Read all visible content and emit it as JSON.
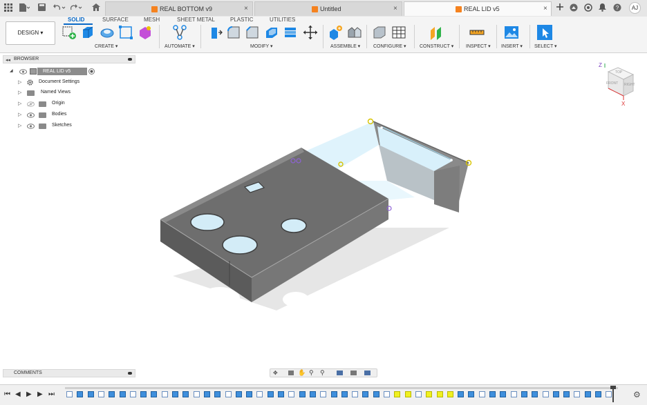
{
  "tabs": [
    {
      "label": "REAL BOTTOM v9",
      "close": "×"
    },
    {
      "label": "Untitled",
      "close": "×"
    },
    {
      "label": "REAL LID v5",
      "close": "×"
    }
  ],
  "user_initials": "AJ",
  "ribbon": {
    "design_label": "DESIGN ▾",
    "tabs": [
      "SOLID",
      "SURFACE",
      "MESH",
      "SHEET METAL",
      "PLASTIC",
      "UTILITIES"
    ],
    "groups": [
      "CREATE ▾",
      "AUTOMATE ▾",
      "MODIFY ▾",
      "ASSEMBLE ▾",
      "CONFIGURE ▾",
      "CONSTRUCT ▾",
      "INSPECT ▾",
      "INSERT ▾",
      "SELECT ▾"
    ]
  },
  "browser": {
    "title": "BROWSER",
    "items": [
      {
        "label": "REAL LID v5"
      },
      {
        "label": "Document Settings"
      },
      {
        "label": "Named Views"
      },
      {
        "label": "Origin"
      },
      {
        "label": "Bodies"
      },
      {
        "label": "Sketches"
      }
    ]
  },
  "viewcube": {
    "top": "TOP",
    "front": "FRONT",
    "right": "RIGHT",
    "axis_z": "Z",
    "axis_x": "X"
  },
  "comments": {
    "title": "COMMENTS"
  },
  "colors": {
    "accent": "#0a69c7",
    "highlight": "#f0f020",
    "body": "#6b6b6b"
  }
}
